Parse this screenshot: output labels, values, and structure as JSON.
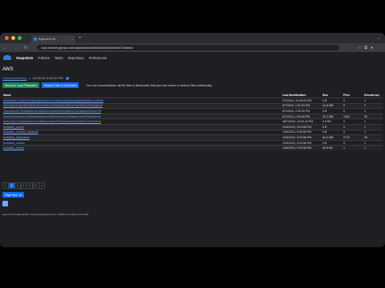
{
  "browser": {
    "tab_title": "Kopia UI 0.15",
    "new_tab": "+",
    "url": "kopia.homelab.gephyra.com/snapshots/dir/k4860e40c2b0e02c9c667d72bd4b6c2",
    "traffic_lights": [
      "#ff5f57",
      "#febc2e",
      "#28c840"
    ]
  },
  "app": {
    "nav": [
      "Snapshots",
      "Policies",
      "Tasks",
      "Repository",
      "Preferences"
    ],
    "active_nav": "Snapshots",
    "heading": "AWS",
    "breadcrumb": {
      "parent": "/Volumes/backup",
      "separator": "|",
      "timestamp": "4/7/2024, 8:00:42 PM"
    },
    "actions": {
      "mount_label": "Mount as Local Filesystem",
      "restore_label": "Restore Files & Directories",
      "hint": "You can mount/restore all the files & directories that you see below or restore files individually."
    },
    "table": {
      "headers": [
        "Name",
        "Last Modification",
        "Size",
        "Files",
        "Directories"
      ],
      "rows": [
        [
          "b3fa00b6c701860527b8e3a6c25e5e7ec18c8a14f0a4ba9da6b08d4bc3108d6e",
          "2/7/2024, 10:09:03 PM",
          "0 B",
          "0",
          "1"
        ],
        [
          "1f2c9d0e41b8c3f97a6d5e2b0c18f4a7d93e6b52c0f81a7d4e96b3c2f0a5d8e1b",
          "5/7/2024, 1:57:04 PM",
          "12.8 MB",
          "6",
          "2"
        ],
        [
          "7a3e4b0c917f2d6a8b5c3e1f04d92a7b6c8e3f1d0a5b9c72e4f6d8a1b3c5e7f9",
          "5/7/2024, 2:00:00 PM",
          "0 B",
          "0",
          "1"
        ],
        [
          "c84e2d1f6a9b3c7e5d0f8a2b4c6e1d3f9a7b5c0e2d4f6a8b1c3e5d7f9a0b2c4e",
          "5/7/2024, 2:00:46 PM",
          "32.2 MB",
          "1264",
          "92"
        ],
        [
          "5d9e1a3c7b2f4e6d8a0c2e4f6b8d1a3c5e7f9b0d2a4c6e8f1b3d5a7c9e0f2b4d",
          "16/7/2024, 12:00:44 PM",
          "3.9 KB",
          "1",
          "1"
        ],
        [
          "buildsets_sector",
          "12/6/2024, 5:03:56 PM",
          "0 B",
          "0",
          "1"
        ],
        [
          "buildsets_content_datasets",
          "12/6/2024, 5:03:56 PM",
          "0 B",
          "0",
          "1"
        ],
        [
          "buildsets_databases",
          "12/6/2024, 5:03:56 PM",
          "84.2 MB",
          "2770",
          "36"
        ],
        [
          "buildsets_cluster",
          "12/6/2024, 5:03:56 PM",
          "0 B",
          "0",
          "1"
        ],
        [
          "buildsets_nodes",
          "12/6/2024, 5:03:56 PM",
          "40.5 KB",
          "1",
          "1"
        ]
      ]
    },
    "pagination": [
      "«",
      "1",
      "2",
      "3",
      "4",
      "5",
      "»"
    ],
    "current_page": "1",
    "page_size_label": "Page Size: 10",
    "footer": "kopia-v0.15.0-build-e44c5f8 - kopia.homelab.gephyra.com, 4-8dc3f17-GC 2024 at 14:33 GMT"
  }
}
